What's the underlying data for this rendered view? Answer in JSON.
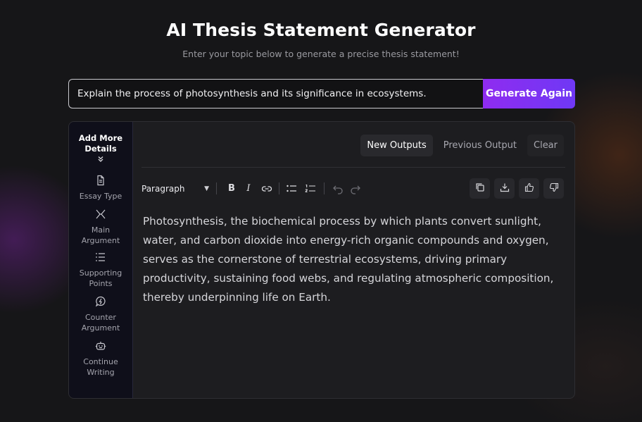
{
  "header": {
    "title": "AI Thesis Statement Generator",
    "subtitle": "Enter your topic below to generate a precise thesis statement!"
  },
  "topic_input": {
    "value": "Explain the process of photosynthesis and its significance in ecosystems."
  },
  "generate_button": {
    "label": "Generate Again"
  },
  "sidebar": {
    "heading": "Add More Details",
    "items": [
      {
        "label_line1": "Essay Type",
        "label_line2": "",
        "icon": "document-icon"
      },
      {
        "label_line1": "Main",
        "label_line2": "Argument",
        "icon": "split-arrows-icon"
      },
      {
        "label_line1": "Supporting",
        "label_line2": "Points",
        "icon": "list-icon"
      },
      {
        "label_line1": "Counter",
        "label_line2": "Argument",
        "icon": "lightning-bubble-icon"
      },
      {
        "label_line1": "Continue",
        "label_line2": "Writing",
        "icon": "robot-icon"
      }
    ]
  },
  "tabs": {
    "new_outputs": "New Outputs",
    "previous_output": "Previous Output",
    "clear": "Clear"
  },
  "toolbar": {
    "block_type": "Paragraph"
  },
  "output": {
    "text": "Photosynthesis, the biochemical process by which plants convert sunlight, water, and carbon dioxide into energy-rich organic compounds and oxygen, serves as the cornerstone of terrestrial ecosystems, driving primary productivity, sustaining food webs, and regulating atmospheric composition, thereby underpinning life on Earth."
  },
  "colors": {
    "accent_start": "#8f2cf0",
    "accent_end": "#6f38f5",
    "background": "#161618",
    "panel": "#1d1d20",
    "sidebar": "#0f0f1a"
  }
}
